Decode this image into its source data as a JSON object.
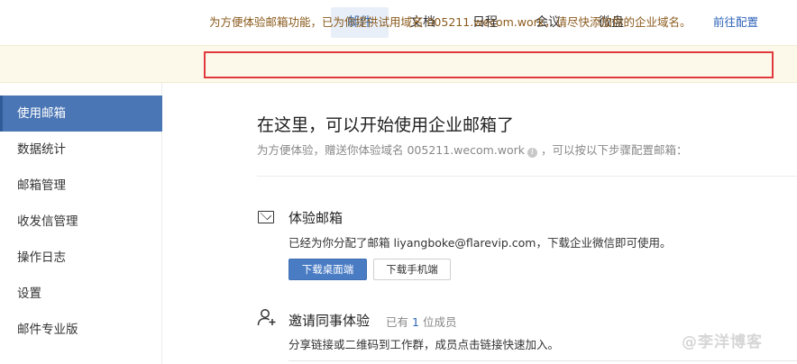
{
  "topnav": {
    "tabs": [
      {
        "label": "邮件",
        "active": true
      },
      {
        "label": "文档",
        "active": false
      },
      {
        "label": "日程",
        "active": false
      },
      {
        "label": "会议",
        "active": false
      },
      {
        "label": "微盘",
        "active": false
      }
    ]
  },
  "notice": {
    "text": "为方便体验邮箱功能，已为你提供试用域名 005211.wecom.work，请尽快添加你的企业域名。",
    "link": "前往配置"
  },
  "sidebar": {
    "items": [
      {
        "label": "使用邮箱",
        "active": true
      },
      {
        "label": "数据统计",
        "active": false
      },
      {
        "label": "邮箱管理",
        "active": false
      },
      {
        "label": "收发信管理",
        "active": false
      },
      {
        "label": "操作日志",
        "active": false
      },
      {
        "label": "设置",
        "active": false
      },
      {
        "label": "邮件专业版",
        "active": false
      }
    ]
  },
  "main": {
    "title": "在这里，可以开始使用企业邮箱了",
    "subtitle_before": "为方便体验，赠送你体验域名 005211.wecom.work",
    "subtitle_after": "，可以按以下步骤配置邮箱："
  },
  "trial": {
    "icon": "mail-icon",
    "title": "体验邮箱",
    "desc": "已经为你分配了邮箱 liyangboke@flarevip.com，下载企业微信即可使用。",
    "download_desktop": "下载桌面端",
    "download_mobile": "下载手机端"
  },
  "invite": {
    "icon": "user-add-icon",
    "title": "邀请同事体验",
    "member_prefix": "已有",
    "member_count": "1",
    "member_suffix": "位成员",
    "desc": "分享链接或二维码到工作群，成员点击链接快速加入。"
  },
  "watermark": "@李洋博客",
  "colors": {
    "accent": "#4a76b5",
    "link": "#2e63b8",
    "notice_bg": "#fdf9ea",
    "notice_border": "#e0393e"
  }
}
